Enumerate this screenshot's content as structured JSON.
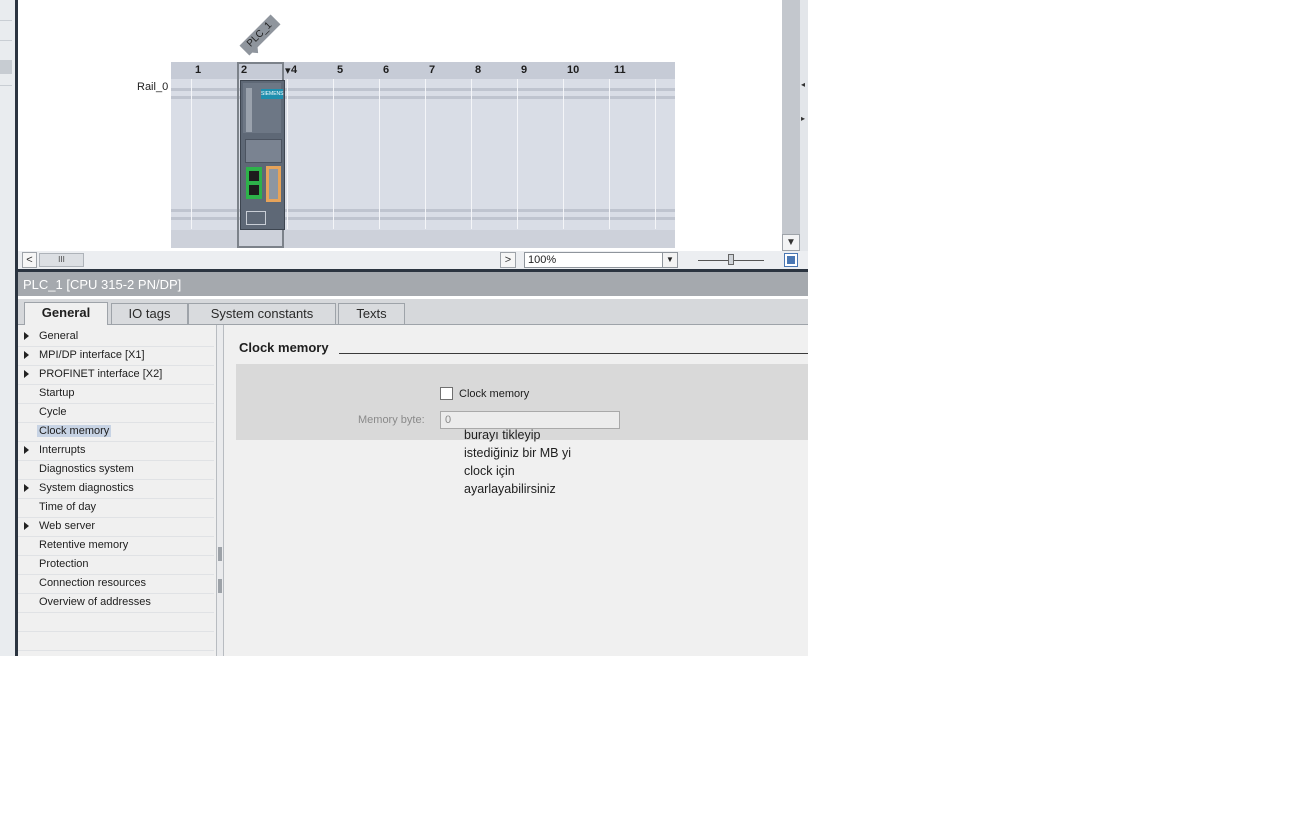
{
  "device_view": {
    "plc_tag": "PLC_1",
    "rail_label": "Rail_0",
    "slots": [
      "1",
      "2",
      "4",
      "5",
      "6",
      "7",
      "8",
      "9",
      "10",
      "11"
    ],
    "module_brand": "SIEMENS",
    "zoom": {
      "value": "100%"
    },
    "hscroll_thumb": "III"
  },
  "properties": {
    "title": "PLC_1 [CPU 315-2 PN/DP]",
    "tabs": [
      {
        "label": "General",
        "active": true
      },
      {
        "label": "IO tags",
        "active": false
      },
      {
        "label": "System constants",
        "active": false
      },
      {
        "label": "Texts",
        "active": false
      }
    ],
    "nav": [
      {
        "label": "General",
        "expandable": true
      },
      {
        "label": "MPI/DP interface [X1]",
        "expandable": true
      },
      {
        "label": "PROFINET interface [X2]",
        "expandable": true
      },
      {
        "label": "Startup",
        "expandable": false
      },
      {
        "label": "Cycle",
        "expandable": false
      },
      {
        "label": "Clock memory",
        "expandable": false,
        "selected": true
      },
      {
        "label": "Interrupts",
        "expandable": true
      },
      {
        "label": "Diagnostics system",
        "expandable": false
      },
      {
        "label": "System diagnostics",
        "expandable": true
      },
      {
        "label": "Time of day",
        "expandable": false
      },
      {
        "label": "Web server",
        "expandable": true
      },
      {
        "label": "Retentive memory",
        "expandable": false
      },
      {
        "label": "Protection",
        "expandable": false
      },
      {
        "label": "Connection resources",
        "expandable": false
      },
      {
        "label": "Overview of addresses",
        "expandable": false
      }
    ],
    "section": {
      "title": "Clock memory",
      "checkbox_label": "Clock memory",
      "checkbox_checked": false,
      "memory_byte_label": "Memory byte:",
      "memory_byte_value": "0"
    },
    "annotation_lines": [
      "burayı tikleyip",
      "istediğiniz bir MB yi",
      "clock için",
      "ayarlayabilirsiniz"
    ]
  },
  "colors": {
    "title_bar": "#a5a9ae",
    "selected_nav": "#c7d3e4",
    "port_green": "#2db34a",
    "port_orange": "#e6a35a",
    "brand_blue": "#1f8fae"
  }
}
